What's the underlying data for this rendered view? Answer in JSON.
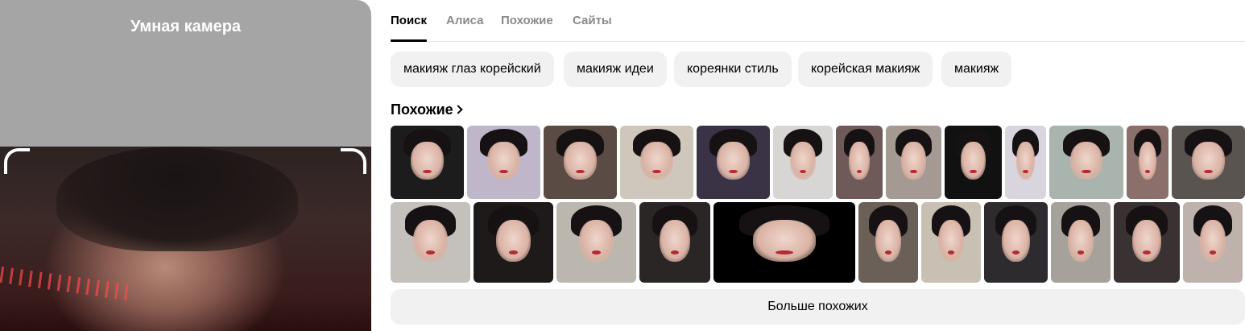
{
  "camera": {
    "title": "Умная камера"
  },
  "tabs": [
    {
      "label": "Поиск",
      "active": true
    },
    {
      "label": "Алиса",
      "active": false
    },
    {
      "label": "Похожие",
      "active": false
    },
    {
      "label": "Сайты",
      "active": false
    }
  ],
  "chips": [
    "макияж глаз корейский",
    "макияж идеи",
    "кореянки стиль",
    "корейская макияж",
    "макияж"
  ],
  "similar": {
    "title": "Похожие",
    "row1_backgrounds": [
      "#1c1c1c",
      "#bfb7c9",
      "#5a4c44",
      "#cfc6bc",
      "#3a3346",
      "#d8d6d4",
      "#6e5a58",
      "#a59a93",
      "#111111",
      "#d9d5de",
      "#a8b4ad",
      "#8a6f6a",
      "#5a5450"
    ],
    "row2_backgrounds": [
      "#c4c0bc",
      "#1e1a1a",
      "#bbb7ae",
      "#2a2626",
      "#000000",
      "#6a6058",
      "#c8c0b3",
      "#2d2b2e",
      "#a7a19c",
      "#3a3232",
      "#bfb2ad"
    ],
    "more_label": "Больше похожих"
  }
}
